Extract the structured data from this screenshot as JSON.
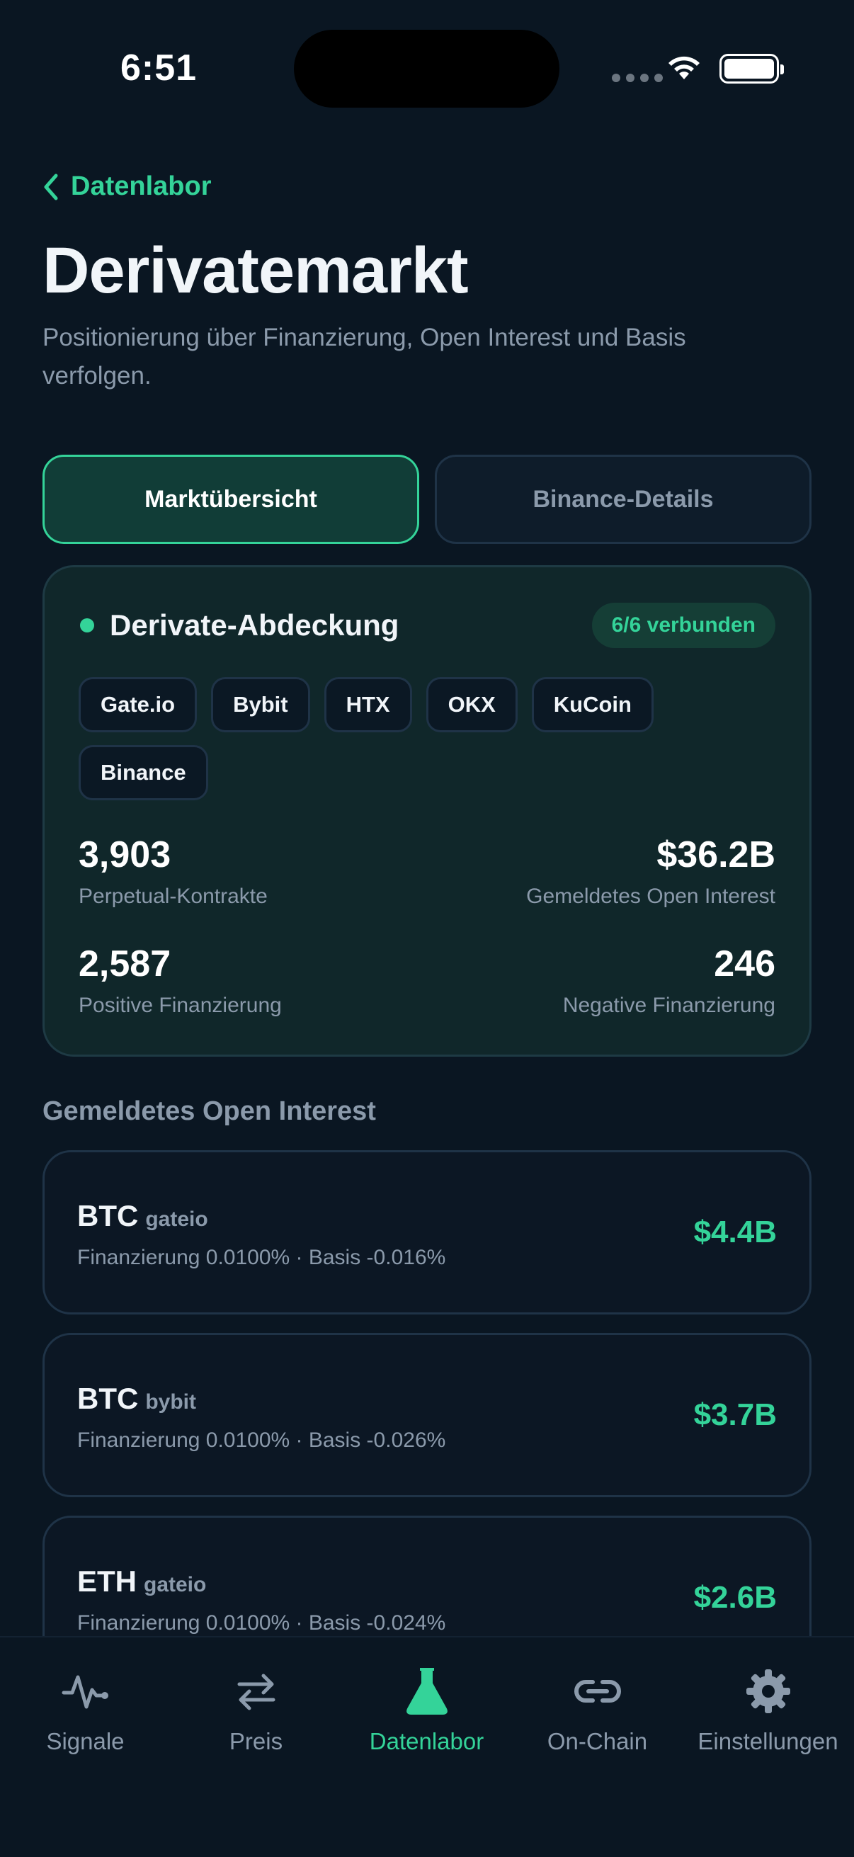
{
  "status_bar": {
    "time": "6:51"
  },
  "header": {
    "back_label": "Datenlabor",
    "title": "Derivatemarkt",
    "subtitle": "Positionierung über Finanzierung, Open Interest und Basis verfolgen."
  },
  "tabs": [
    {
      "label": "Marktübersicht",
      "active": true
    },
    {
      "label": "Binance-Details",
      "active": false
    }
  ],
  "coverage": {
    "title": "Derivate-Abdeckung",
    "badge": "6/6 verbunden",
    "exchanges": [
      "Gate.io",
      "Bybit",
      "HTX",
      "OKX",
      "KuCoin",
      "Binance"
    ],
    "stats": {
      "perpetual_count": "3,903",
      "perpetual_label": "Perpetual-Kontrakte",
      "open_interest": "$36.2B",
      "open_interest_label": "Gemeldetes Open Interest",
      "positive_funding": "2,587",
      "positive_funding_label": "Positive Finanzierung",
      "negative_funding": "246",
      "negative_funding_label": "Negative Finanzierung"
    }
  },
  "open_interest_section": {
    "title": "Gemeldetes Open Interest",
    "items": [
      {
        "symbol": "BTC",
        "exchange": "gateio",
        "meta": "Finanzierung 0.0100% · Basis -0.016%",
        "value": "$4.4B"
      },
      {
        "symbol": "BTC",
        "exchange": "bybit",
        "meta": "Finanzierung 0.0100% · Basis -0.026%",
        "value": "$3.7B"
      },
      {
        "symbol": "ETH",
        "exchange": "gateio",
        "meta": "Finanzierung 0.0100% · Basis -0.024%",
        "value": "$2.6B"
      }
    ]
  },
  "tab_bar": {
    "items": [
      {
        "label": "Signale",
        "icon": "pulse-icon",
        "active": false
      },
      {
        "label": "Preis",
        "icon": "swap-arrows-icon",
        "active": false
      },
      {
        "label": "Datenlabor",
        "icon": "flask-icon",
        "active": true
      },
      {
        "label": "On-Chain",
        "icon": "link-icon",
        "active": false
      },
      {
        "label": "Einstellungen",
        "icon": "gear-icon",
        "active": false
      }
    ]
  },
  "colors": {
    "background": "#0a1622",
    "accent": "#34d399",
    "muted": "#8b9aab"
  }
}
